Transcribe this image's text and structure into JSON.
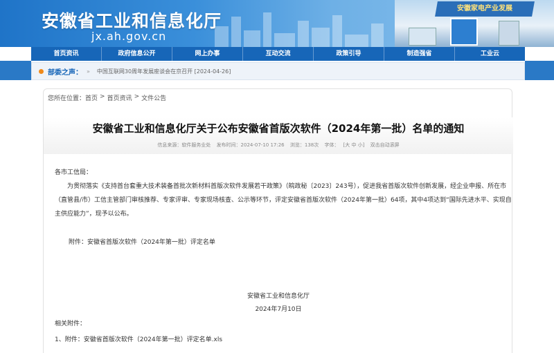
{
  "header": {
    "site_title": "安徽省工业和信息化厅",
    "site_domain": "jx.ah.gov.cn",
    "expo_sign": "安徽家电产业发展"
  },
  "nav": {
    "items": [
      {
        "label": "首页资讯"
      },
      {
        "label": "政府信息公开"
      },
      {
        "label": "网上办事"
      },
      {
        "label": "互动交流"
      },
      {
        "label": "政策引导"
      },
      {
        "label": "制造强省"
      },
      {
        "label": "工业云"
      }
    ]
  },
  "ticker": {
    "label": "部委之声：",
    "news": "中国互联网30周年发展座谈会在京召开 [2024-04-26]"
  },
  "breadcrumb": {
    "prefix": "您所在位置：",
    "items": [
      "首页",
      "首页资讯",
      "文件公告"
    ]
  },
  "article": {
    "title": "安徽省工业和信息化厅关于公布安徽省首版次软件（2024年第一批）名单的通知",
    "meta_source": "信息来源：软件服务业处",
    "meta_date": "发布时间：2024-07-10 17:26",
    "meta_views": "浏览：138次",
    "meta_font": "字体：",
    "meta_font_size": "[大 中 小]",
    "meta_scroll": "双击自动滚屏",
    "salutation": "各市工信局：",
    "paragraph": "为贯彻落实《支持首台套重大技术装备首批次新材料首版次软件发展若干政策》（皖政秘〔2023〕243号），促进我省首版次软件创新发展，经企业申报、所在市（直管县/市）工信主管部门审核推荐、专家评审、专家现场核查、公示等环节，评定安徽省首版次软件（2024年第一批）64项，其中4项达到“国际先进水平、实现自主供应能力”，现予以公布。",
    "attachment": "附件：安徽省首版次软件（2024年第一批）评定名单",
    "signer": "安徽省工业和信息化厅",
    "sign_date": "2024年7月10日",
    "related_label": "相关附件：",
    "related_file": "1、附件：安徽省首版次软件（2024年第一批）评定名单.xls"
  },
  "colors": {
    "nav_blue": "#1766b8",
    "accent_orange": "#f08a1a",
    "banner_blue": "#1f74c8"
  }
}
